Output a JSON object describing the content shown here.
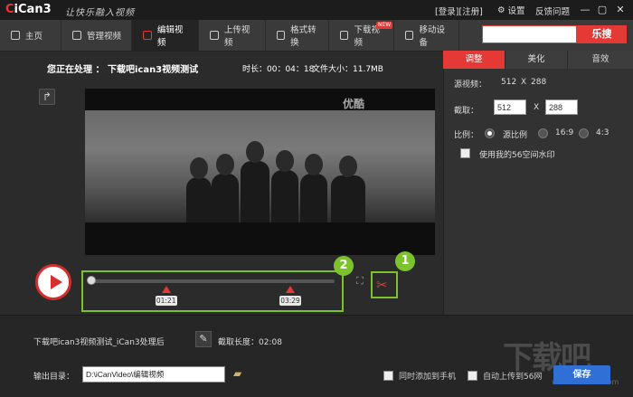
{
  "app": {
    "logo": "iCan3",
    "logo_c": "C",
    "slogan": "让快乐融入视频",
    "login": "[登录][注册]",
    "settings": "设置",
    "feedback": "反馈问题"
  },
  "window": {
    "minimize": "—",
    "maximize": "▢",
    "close": "✕"
  },
  "nav": {
    "items": [
      {
        "label": "主页"
      },
      {
        "label": "管理视频"
      },
      {
        "label": "编辑视频"
      },
      {
        "label": "上传视频"
      },
      {
        "label": "格式转换"
      },
      {
        "label": "下载视频"
      },
      {
        "label": "移动设备"
      }
    ],
    "new_badge": "NEW",
    "search_placeholder": "",
    "search_button": "乐搜"
  },
  "editor": {
    "processing": "您正在处理 ： 下载吧ican3视频测试",
    "duration": "时长：00：04：18",
    "filesize": "文件大小：11.7MB",
    "watermark": "优酷",
    "marker1": "01:21",
    "marker2": "03:29",
    "progress_start": 0,
    "marker1_fraction": 0.315,
    "marker2_fraction": 0.82,
    "callout1": "1",
    "callout2": "2"
  },
  "panel": {
    "tabs": [
      "调整",
      "美化",
      "音效"
    ],
    "source_label": "源视频：",
    "source_w": "512",
    "source_x": "X",
    "source_h": "288",
    "crop_label": "截取：",
    "crop_w": "512",
    "crop_x": "X",
    "crop_h": "288",
    "ratio_label": "比例：",
    "ratio_options": [
      "源比例",
      "16:9",
      "4:3"
    ],
    "watermark_check": "使用我的56空间水印"
  },
  "bottom": {
    "filename": "下载吧ican3视频测试_iCan3处理后",
    "cut_length": "截取长度：02:08",
    "outdir_label": "输出目录：",
    "outdir_value": "D:\\iCanVideo\\编辑视频",
    "add_phone": "同时添加到手机",
    "upload_56": "自动上传到56网",
    "save": "保存",
    "site_watermark": "下载吧",
    "site_url": "www.xiazaiba.com"
  },
  "colors": {
    "accent": "#e53935",
    "highlight": "#7cc22c",
    "save": "#2f6fd6"
  }
}
